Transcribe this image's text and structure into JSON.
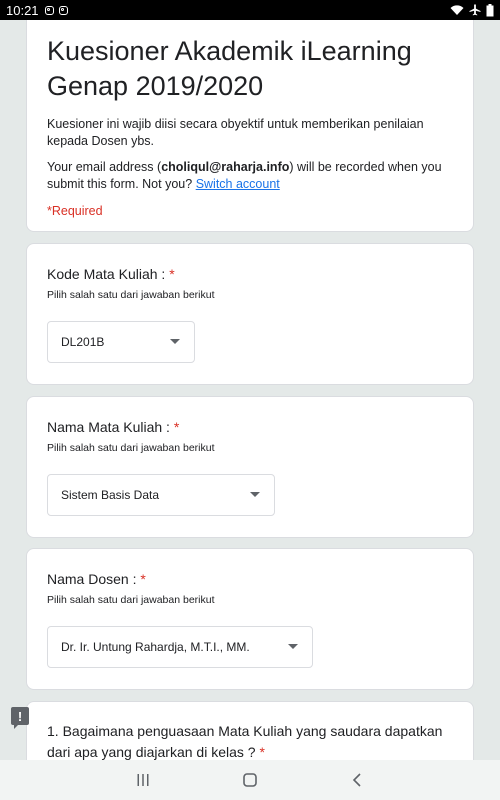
{
  "status_bar": {
    "time": "10:21",
    "left_icons": [
      "instagram-icon",
      "instagram-icon"
    ],
    "right_icons": [
      "wifi-icon",
      "airplane-icon",
      "battery-icon"
    ]
  },
  "form": {
    "title": "Kuesioner Akademik iLearning Genap 2019/2020",
    "description": "Kuesioner ini wajib diisi secara obyektif untuk memberikan penilaian kepada Dosen ybs.",
    "email_prefix": "Your email address (",
    "email": "choliqul@raharja.info",
    "email_suffix": ") will be recorded when you submit this form. Not you?",
    "switch_account": "Switch account",
    "required_note": "*Required"
  },
  "questions": [
    {
      "title": "Kode Mata Kuliah :",
      "required": "*",
      "hint": "Pilih salah satu dari jawaban berikut",
      "selected": "DL201B"
    },
    {
      "title": "Nama Mata Kuliah :",
      "required": "*",
      "hint": "Pilih salah satu dari jawaban berikut",
      "selected": "Sistem Basis Data"
    },
    {
      "title": "Nama Dosen :",
      "required": "*",
      "hint": "Pilih salah satu dari jawaban berikut",
      "selected": "Dr. Ir. Untung Rahardja, M.T.I., MM."
    },
    {
      "title": "1. Bagaimana penguasaan Mata Kuliah yang saudara dapatkan dari apa yang diajarkan di kelas ?",
      "required": "*"
    }
  ],
  "feedback": {
    "icon": "feedback-icon",
    "glyph": "!"
  },
  "nav_bar": {
    "buttons": [
      "recent-apps-icon",
      "home-icon",
      "back-icon"
    ]
  }
}
